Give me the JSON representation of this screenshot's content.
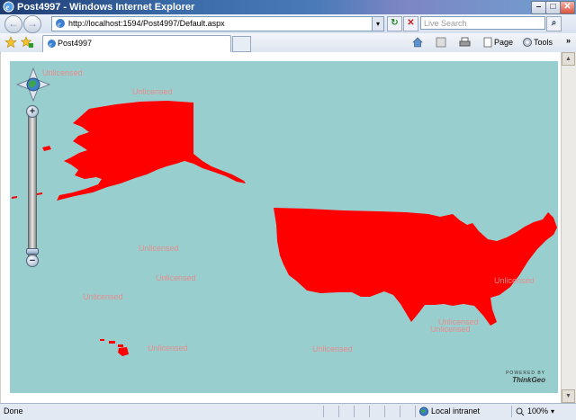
{
  "window": {
    "title": "Post4997 - Windows Internet Explorer",
    "minimize_glyph": "–",
    "maximize_glyph": "□",
    "close_glyph": "✕"
  },
  "nav": {
    "back_glyph": "←",
    "forward_glyph": "→",
    "address_url": "http://localhost:1594/Post4997/Default.aspx",
    "dropdown_glyph": "▾",
    "refresh_glyph": "↻",
    "stop_glyph": "✕",
    "search_placeholder": "Live Search",
    "search_button_glyph": "⌕"
  },
  "tabs": [
    {
      "label": "Post4997"
    }
  ],
  "commands": {
    "page_label": "Page",
    "tools_label": "Tools",
    "chevron_glyph": "»"
  },
  "map": {
    "background_color": "#99cece",
    "land_color": "#ff0000",
    "label_color": "#e58e8e",
    "labels": [
      "Unlicensed",
      "Unlicensed",
      "Unlicensed",
      "Unlicensed",
      "Unlicensed",
      "Unlicensed",
      "Unlicensed",
      "Unlicensed",
      "Unlicensed",
      "Unlicensed"
    ],
    "zoom_in_glyph": "+",
    "zoom_out_glyph": "−",
    "logo_powered": "POWERED BY",
    "logo_brand": "ThinkGeo"
  },
  "status": {
    "text": "Done",
    "zone": "Local intranet",
    "zoom": "100%"
  }
}
